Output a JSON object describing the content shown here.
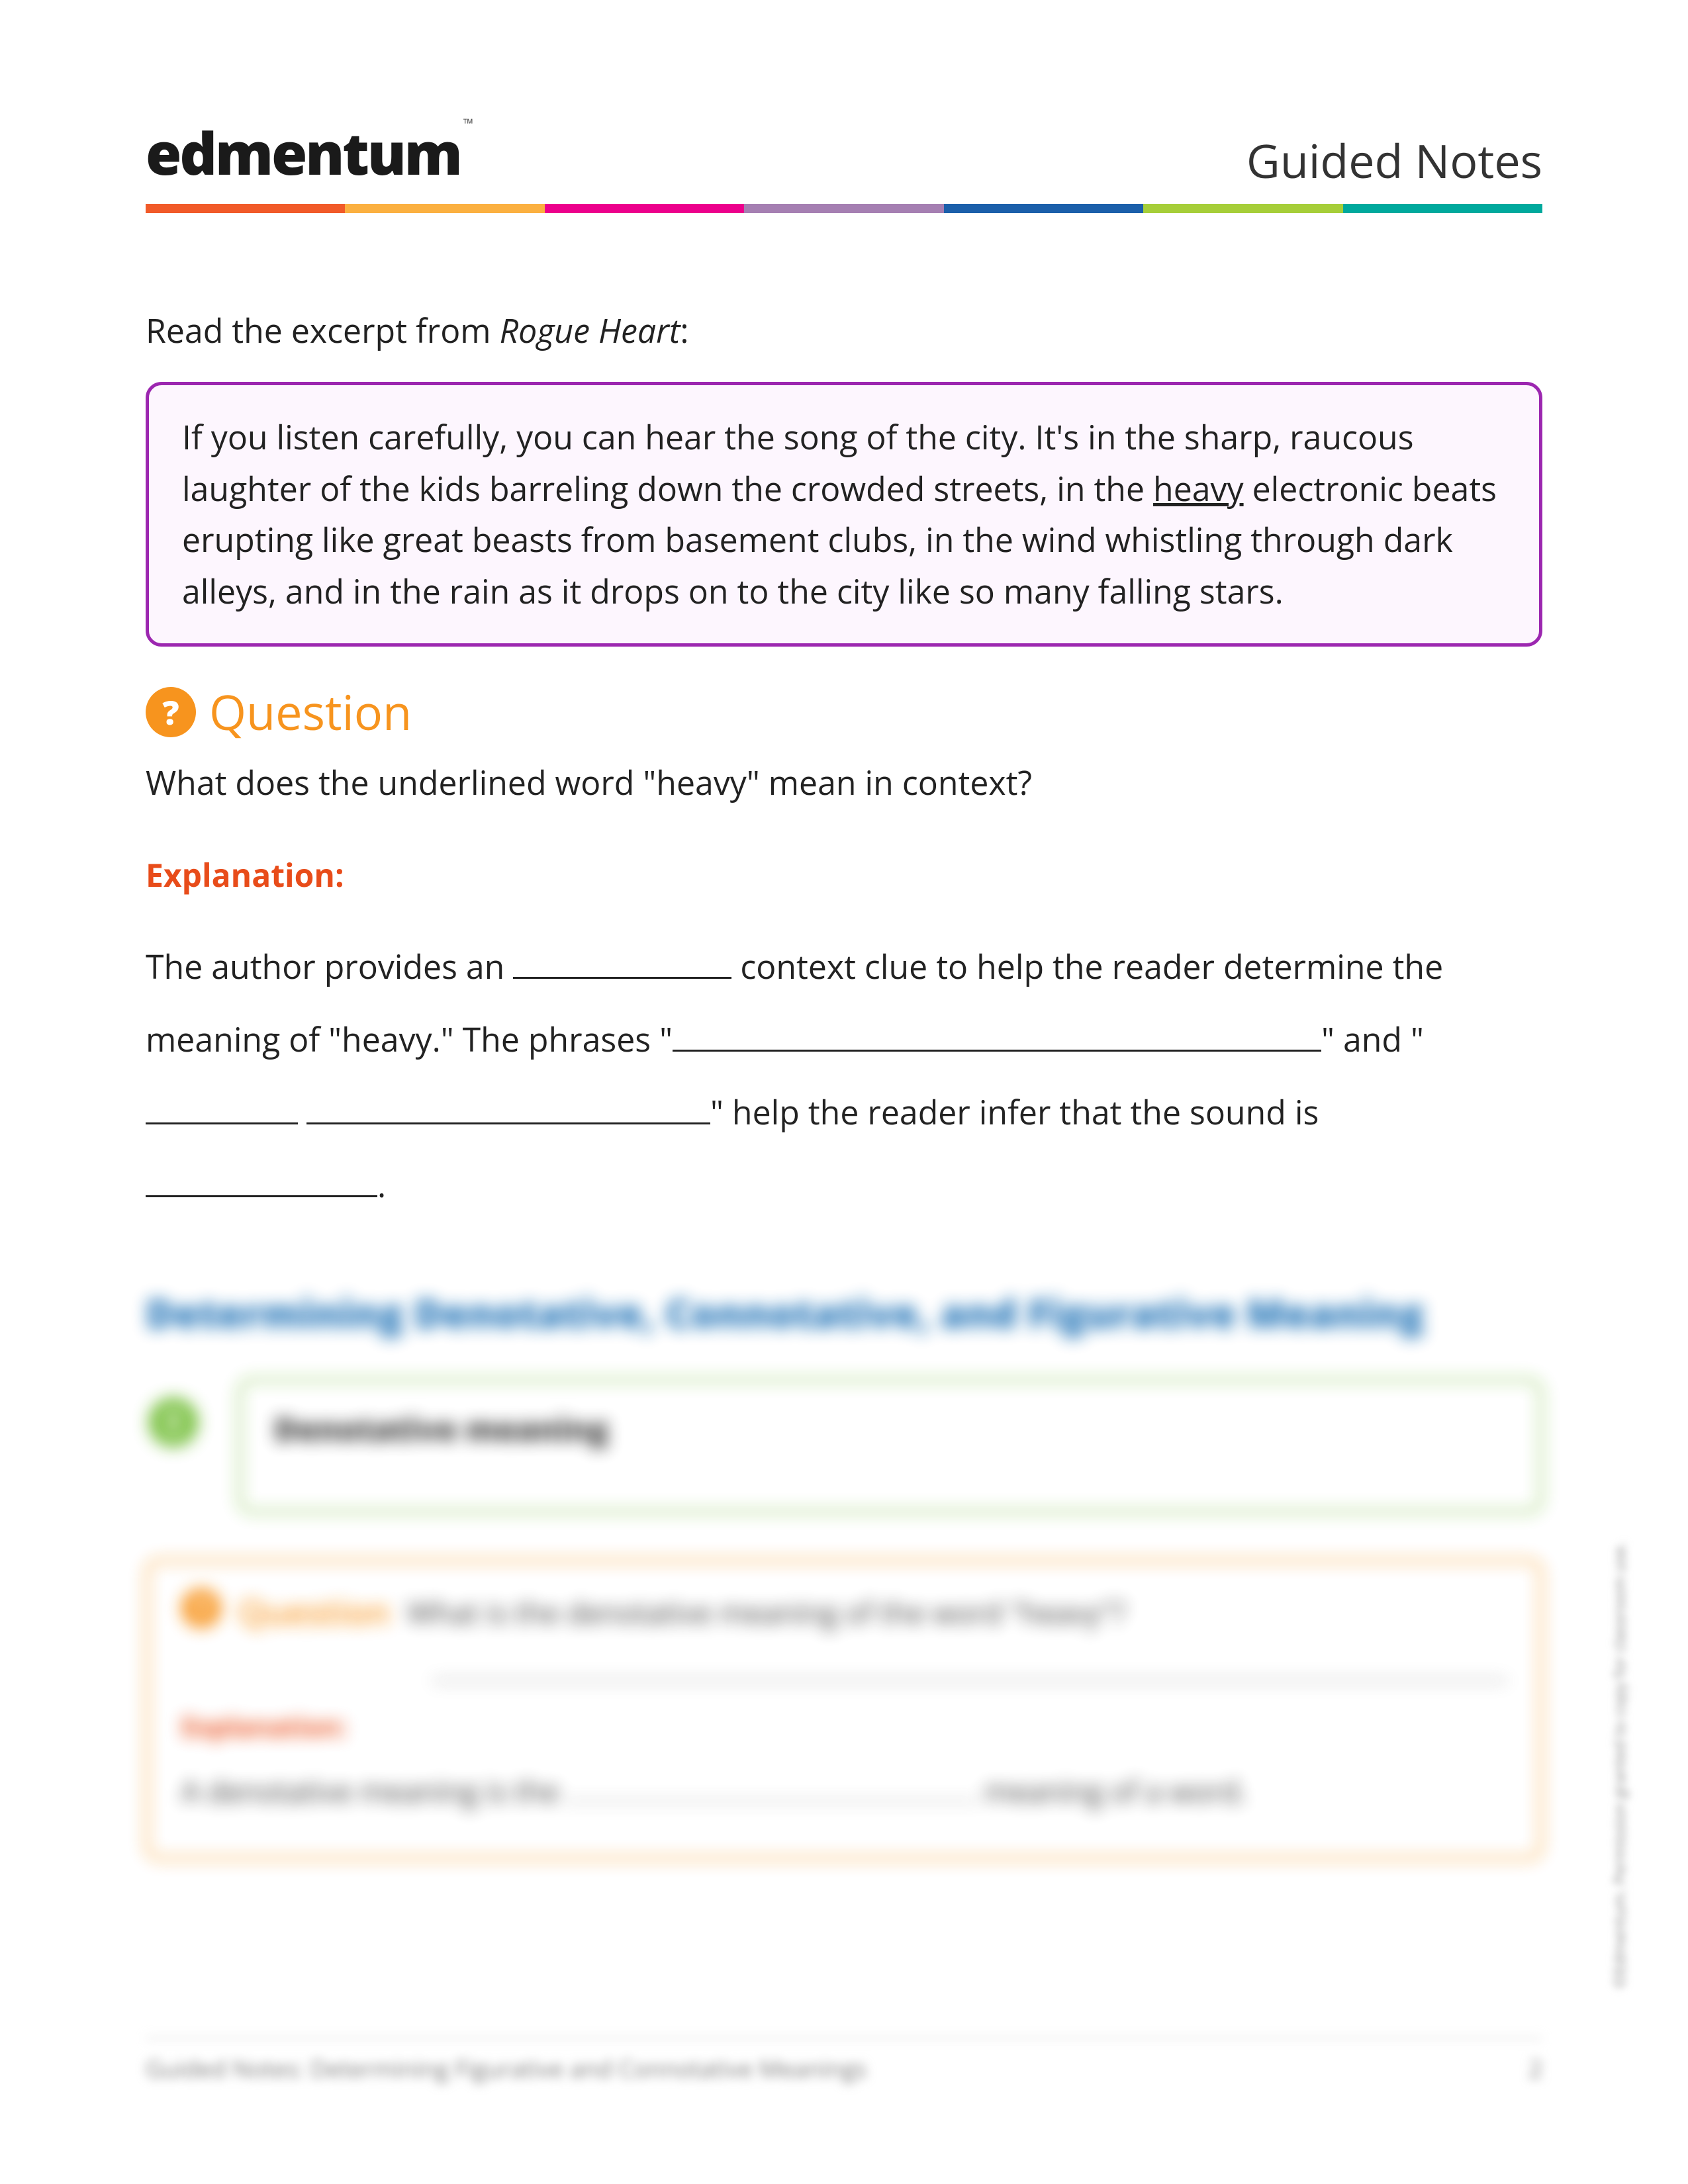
{
  "header": {
    "logo_text": "edmentum",
    "tm": "™",
    "title": "Guided Notes"
  },
  "colorbar": [
    "#f15a29",
    "#fbb040",
    "#ec008c",
    "#a57fb2",
    "#1b5faa",
    "#a6ce39",
    "#00a99d"
  ],
  "intro": {
    "prefix": "Read the excerpt from ",
    "title": "Rogue Heart",
    "suffix": ":"
  },
  "excerpt": {
    "part1": "If you listen carefully, you can hear the song of the city. It's in the sharp, raucous laughter of the kids barreling down the crowded streets, in the ",
    "underlined": "heavy",
    "part2": " electronic beats erupting like great beasts from basement clubs, in the wind whistling through dark alleys, and in the rain as it drops on to the city like so many falling stars."
  },
  "question": {
    "icon": "?",
    "label": "Question",
    "text": "What does the underlined word \"heavy\" mean in context?"
  },
  "explanation": {
    "label": "Explanation:",
    "seg1": "The author provides an ",
    "seg2": " context clue to help the reader determine the meaning of \"heavy.\" The phrases \"",
    "seg3": "\"  and  \"",
    "seg4": "\" help the reader infer that the sound is ",
    "seg5": "."
  },
  "blurred": {
    "section_title": "Determining Denotative, Connotative, and Figurative Meaning",
    "def_icon": "!",
    "def_title": "Denotative meaning",
    "q_icon": "?",
    "q_label": "Question",
    "q_text": "What is the denotative meaning of the word \"heavy\"?",
    "expl_label": "Explanation:",
    "fill_a": "A denotative meaning is the ",
    "fill_b": " meaning of a word."
  },
  "side_copyright": "©Edmentum. Permission granted to copy for classroom use.",
  "footer": {
    "left": "Guided Notes: Determining Figurative and Connotative Meanings",
    "right": "2"
  }
}
